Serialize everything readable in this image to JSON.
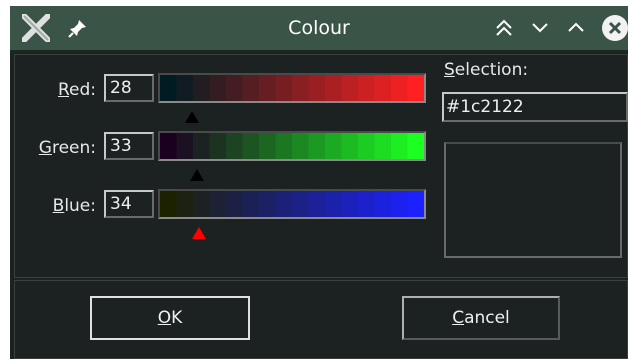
{
  "window": {
    "title": "Colour",
    "controls": [
      "pin-icon",
      "shade-icon",
      "minimize-icon",
      "maximize-icon",
      "close-icon"
    ]
  },
  "red": {
    "label": "Red:",
    "value": "28",
    "from": "#001c22",
    "to": "#ff2122"
  },
  "green": {
    "label": "Green:",
    "value": "33",
    "from": "#1c0022",
    "to": "#1cff22"
  },
  "blue": {
    "label": "Blue:",
    "value": "34",
    "from": "#1c2100",
    "to": "#1c21ff"
  },
  "selection": {
    "label": "Selection:",
    "value": "#1c2122",
    "swatch_color": "#1c2122"
  },
  "buttons": {
    "ok": "OK",
    "cancel": "Cancel"
  },
  "colors": {
    "titlebar": "#3a5548",
    "background": "#1c2122",
    "active_marker": "#ff0000"
  }
}
